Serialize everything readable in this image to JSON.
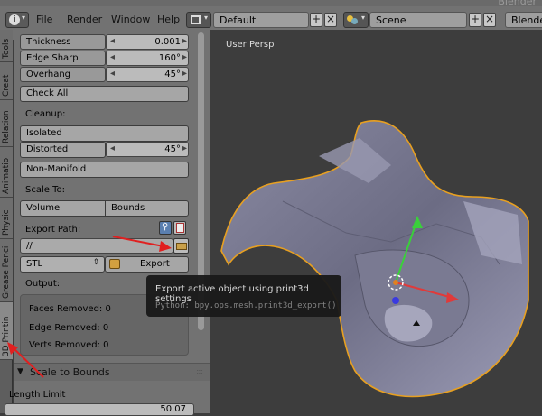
{
  "app_title": "Blender",
  "menu": [
    "File",
    "Render",
    "Window",
    "Help"
  ],
  "layout": "Default",
  "scene": "Scene",
  "engine": "Blender",
  "tabs": [
    "Tools",
    "Creat",
    "Relation",
    "Animatio",
    "Physic",
    "Grease Penci",
    "3D Printin"
  ],
  "panel": {
    "thickness_label": "Thickness",
    "thickness_value": "0.001",
    "edge_sharp_label": "Edge Sharp",
    "edge_sharp_value": "160°",
    "overhang_label": "Overhang",
    "overhang_value": "45°",
    "check_all": "Check All",
    "cleanup": "Cleanup:",
    "isolated": "Isolated",
    "distorted": "Distorted",
    "distorted_value": "45°",
    "non_manifold": "Non-Manifold",
    "scale_to": "Scale To:",
    "volume": "Volume",
    "bounds": "Bounds",
    "export_path_label": "Export Path:",
    "export_path_value": "//",
    "format": "STL",
    "export": "Export",
    "output": "Output:",
    "faces_removed": "Faces Removed: 0",
    "edge_removed": "Edge Removed: 0",
    "verts_removed": "Verts Removed: 0",
    "scale_to_bounds": "Scale to Bounds",
    "length_limit": "Length Limit",
    "length_value": "50.07"
  },
  "viewport": {
    "label": "User Persp"
  },
  "tooltip": {
    "title": "Export active object using print3d settings",
    "python": "Python: bpy.ops.mesh.print3d_export()"
  },
  "colors": {
    "selection_outline": "#e8a020",
    "annotation_arrow": "#e02020"
  }
}
